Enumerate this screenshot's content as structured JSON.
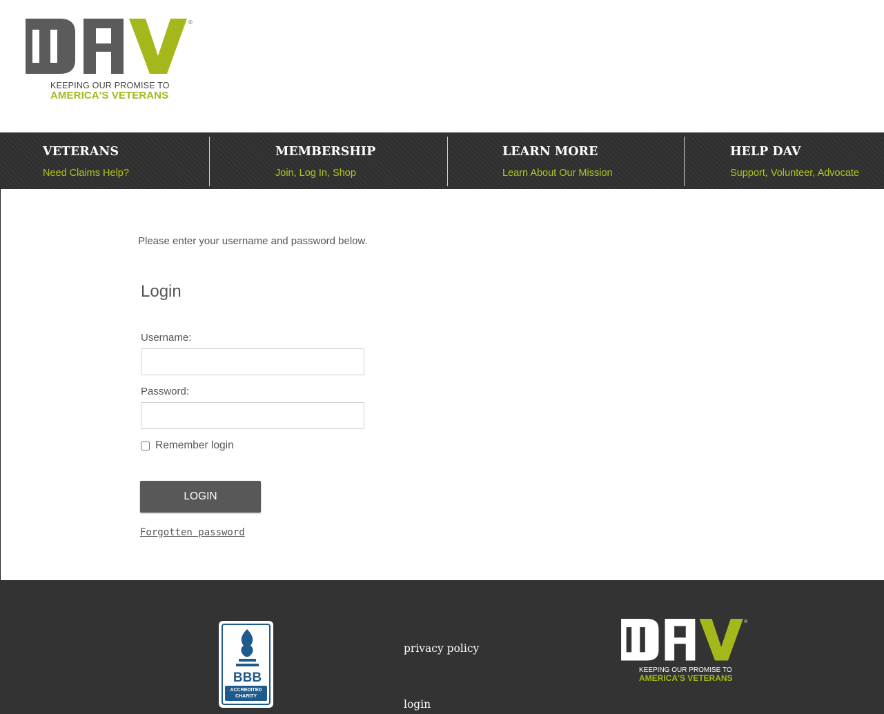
{
  "brand": {
    "logo_letters": "DAV",
    "tagline_line1": "KEEPING OUR PROMISE TO",
    "tagline_line2": "AMERICA'S VETERANS",
    "registered_mark": "®",
    "colors": {
      "green": "#a4b81c",
      "gray": "#5b5b5b",
      "nav_bg": "#2f2f2f",
      "footer_bg": "#333333"
    }
  },
  "nav": {
    "items": [
      {
        "title": "VETERANS",
        "subtitle": "Need Claims Help?"
      },
      {
        "title": "MEMBERSHIP",
        "subtitle": "Join, Log In, Shop"
      },
      {
        "title": "LEARN MORE",
        "subtitle": "Learn About Our Mission"
      },
      {
        "title": "HELP DAV",
        "subtitle": "Support, Volunteer, Advocate"
      }
    ]
  },
  "login": {
    "intro": "Please enter your username and password below.",
    "title": "Login",
    "username_label": "Username:",
    "username_value": "",
    "password_label": "Password:",
    "password_value": "",
    "remember_label": "Remember login",
    "remember_checked": false,
    "submit_label": "LOGIN",
    "forgot_label": "Forgotten password"
  },
  "footer": {
    "bbb": {
      "letters": "BBB",
      "badge_line1": "ACCREDITED",
      "badge_line2": "CHARITY"
    },
    "links": [
      "privacy policy",
      "login"
    ]
  }
}
